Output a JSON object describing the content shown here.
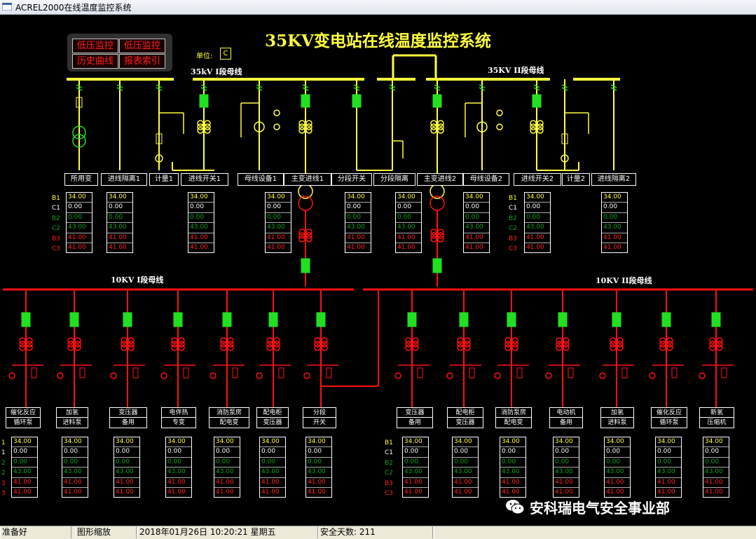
{
  "window": {
    "title": "ACREL2000在线温度监控系统"
  },
  "screen": {
    "title": "35KV变电站在线温度监控系统",
    "unit_label": "单位:",
    "unit_value": "C"
  },
  "menu": {
    "btn1": "低压监控",
    "btn2": "低压监控",
    "btn3": "历史曲线",
    "btn4": "报表索引"
  },
  "buses": {
    "hv1": "35kV I段母线",
    "hv2": "35KV II段母线",
    "lv1": "10KV I段母线",
    "lv2": "10KV II段母线"
  },
  "hv_devices": [
    "所用变",
    "进线隔离1",
    "计量1",
    "进线开关1",
    "母线设备1",
    "主变进线1",
    "分段开关",
    "分段隔离",
    "主变进线2",
    "母线设备2",
    "进线开关2",
    "计量2",
    "进线隔离2"
  ],
  "lv_devices_left": [
    [
      "催化反应",
      "循环泵"
    ],
    [
      "加氢",
      "进料泵"
    ],
    [
      "变压器",
      "备用"
    ],
    [
      "电伴热",
      "专变"
    ],
    [
      "消防泵房",
      "配电变"
    ],
    [
      "配电柜",
      "变压器"
    ],
    [
      "分段",
      "开关"
    ]
  ],
  "lv_devices_right": [
    [
      "变压器",
      "备用"
    ],
    [
      "配电柜",
      "变压器"
    ],
    [
      "消防泵房",
      "配电变"
    ],
    [
      "电动机",
      "备用"
    ],
    [
      "加氢",
      "进料泵"
    ],
    [
      "催化反应",
      "循环泵"
    ],
    [
      "新氢",
      "压缩机"
    ]
  ],
  "row_labels": [
    "B1",
    "C1",
    "B2",
    "C2",
    "B3",
    "C3"
  ],
  "row_labels_partial": [
    "1",
    "1",
    "2",
    "2",
    "3",
    "3"
  ],
  "readings": [
    "34.00",
    "0.00",
    "0.00",
    "43.00",
    "41.00",
    "41.00"
  ],
  "reading_colors": [
    "#ffff40",
    "#ffffff",
    "#10a020",
    "#10a020",
    "#ff2020",
    "#ff2020"
  ],
  "colors": {
    "hv": "#ffff40",
    "lv": "#ff1010",
    "breaker": "#20e020",
    "accent": "#ffff40"
  },
  "watermark": {
    "text": "安科瑞电气安全事业部"
  },
  "status": {
    "ready": "准备好",
    "zoom": "图形缩放",
    "datetime": "2018年01月26日   10:20:21   星期五",
    "safe_days": "安全天数: 211"
  }
}
